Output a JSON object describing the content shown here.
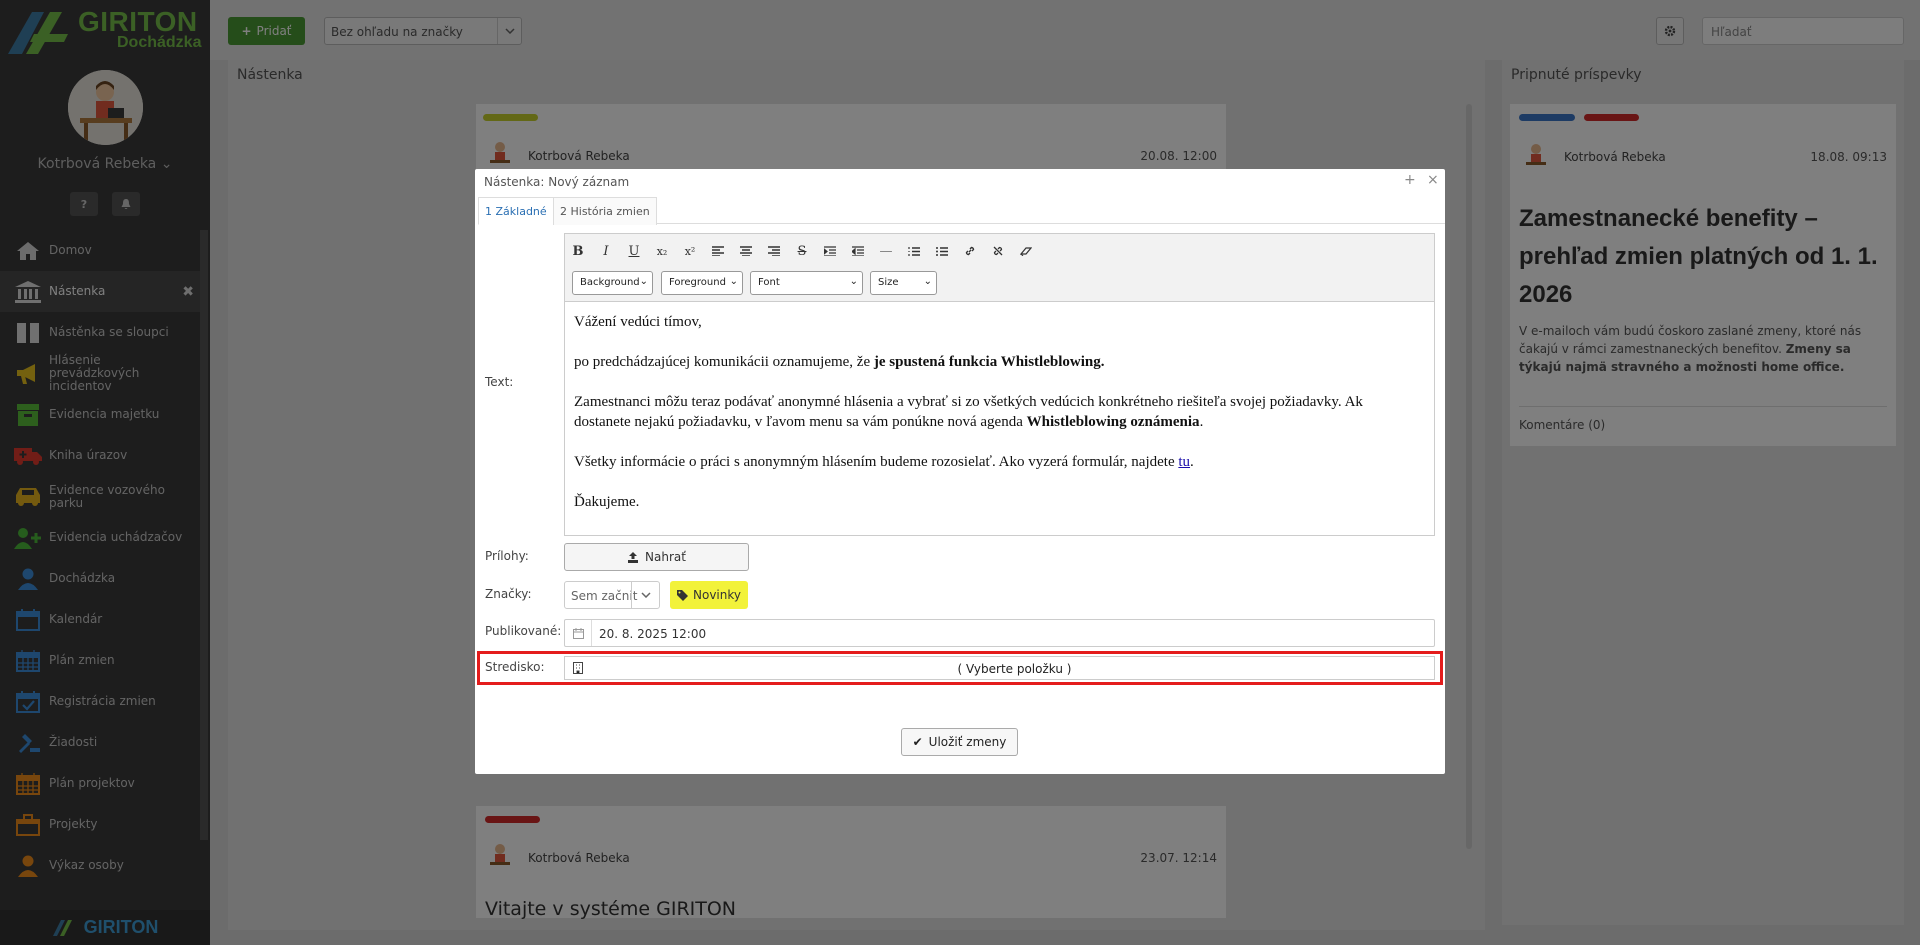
{
  "app": {
    "logo_text": "GIRITON",
    "logo_subtitle": "Dochádzka",
    "footer_logo": "GIRITON"
  },
  "user": {
    "name": "Kotrbová Rebeka",
    "chevron": "chevron-down-icon"
  },
  "sidebar": {
    "items": [
      {
        "label": "Domov",
        "icon": "home-icon",
        "color": "#d9d9d9"
      },
      {
        "label": "Nástenka",
        "icon": "bank-icon",
        "color": "#e0e0e0",
        "active": true,
        "close": "✖"
      },
      {
        "label": "Nástěnka se sloupci",
        "icon": "columns-icon",
        "color": "#e0e0e0"
      },
      {
        "label": "Hlásenie prevádzkových incidentov",
        "icon": "megaphone-icon",
        "color": "#e9c31e"
      },
      {
        "label": "Evidencia majetku",
        "icon": "box-icon",
        "color": "#5bbf3a"
      },
      {
        "label": "Kniha úrazov",
        "icon": "ambulance-icon",
        "color": "#e23b2e"
      },
      {
        "label": "Evidence vozového parku",
        "icon": "car-icon",
        "color": "#e9b51e"
      },
      {
        "label": "Evidencia uchádzačov",
        "icon": "user-plus-icon",
        "color": "#4cba3a"
      },
      {
        "label": "Dochádzka",
        "icon": "user-icon",
        "color": "#3c8fdc"
      },
      {
        "label": "Kalendár",
        "icon": "calendar-icon",
        "color": "#3c8fdc"
      },
      {
        "label": "Plán zmien",
        "icon": "calendar-grid-icon",
        "color": "#3c8fdc"
      },
      {
        "label": "Registrácia zmien",
        "icon": "calendar-check-icon",
        "color": "#3c8fdc"
      },
      {
        "label": "Žiadosti",
        "icon": "gavel-icon",
        "color": "#3c8fdc"
      },
      {
        "label": "Plán projektov",
        "icon": "calendar-grid-icon",
        "color": "#f08c1a"
      },
      {
        "label": "Projekty",
        "icon": "briefcase-icon",
        "color": "#f08c1a"
      },
      {
        "label": "Výkaz osoby",
        "icon": "user-icon",
        "color": "#f08c1a"
      }
    ]
  },
  "topbar": {
    "add_label": "Pridať",
    "view_select": "Bez ohľadu na značky",
    "search_placeholder": "Hľadať"
  },
  "board": {
    "title": "Nástenka",
    "posts": [
      {
        "tag_color": "#c7d12c",
        "author": "Kotrbová Rebeka",
        "date": "20.08. 12:00"
      },
      {
        "tag_color": "#d32a2a",
        "author": "Kotrbová Rebeka",
        "date": "23.07. 12:14",
        "title": "Vitajte v systéme GIRITON"
      }
    ]
  },
  "pinned": {
    "title": "Pripnuté príspevky",
    "post": {
      "tag_colors": [
        "#3a77c9",
        "#d32a2a"
      ],
      "author": "Kotrbová Rebeka",
      "date": "18.08. 09:13",
      "title": "Zamestnanecké benefity – prehľad zmien platných od 1. 1. 2026",
      "text": "V e-mailoch vám budú čoskoro zaslané zmeny, ktoré nás čakajú v rámci zamestnaneckých benefitov.",
      "text_bold": "Zmeny sa týkajú najmä stravného a možnosti home office.",
      "comments": "Komentáre (0)"
    }
  },
  "modal": {
    "title": "Nástenka: Nový záznam",
    "maximize": "+",
    "close": "×",
    "tabs": [
      "1 Základné",
      "2 História zmien"
    ],
    "labels": {
      "text": "Text:",
      "attachments": "Prílohy:",
      "tags": "Značky:",
      "published": "Publikované:",
      "center": "Stredisko:"
    },
    "editor": {
      "toolbar_selects": [
        "Background",
        "Foreground",
        "Font",
        "Size"
      ],
      "greeting": "Vážení vedúci tímov,",
      "p1_pre": "po predchádzajúcej komunikácii oznamujeme, že ",
      "p1_bold": "je spustená funkcia Whistleblowing.",
      "p2_pre": "Zamestnanci môžu teraz podávať anonymné hlásenia a vybrať si zo všetkých vedúcich konkrétneho riešiteľa svojej požiadavky. Ak dostanete nejakú požiadavku, v ľavom menu sa vám ponúkne nová agenda ",
      "p2_bold": "Whistleblowing oznámenia",
      "p2_post": ".",
      "p3_pre": "Všetky informácie o práci s anonymným hlásením budeme rozosielať. Ako vyzerá formulár, najdete ",
      "p3_link": "tu",
      "p3_post": ".",
      "closing": "Ďakujeme."
    },
    "upload_label": "Nahrať",
    "tag_placeholder": "Sem začnit",
    "tag_badge": "Novinky",
    "published_value": "20. 8. 2025 12:00",
    "center_value": "( Vyberte položku )",
    "save_label": "Uložiť zmeny"
  },
  "colors": {
    "accent_green": "#4a9a34",
    "highlight_red": "#e41c1c",
    "badge_yellow": "#f2f23a"
  }
}
